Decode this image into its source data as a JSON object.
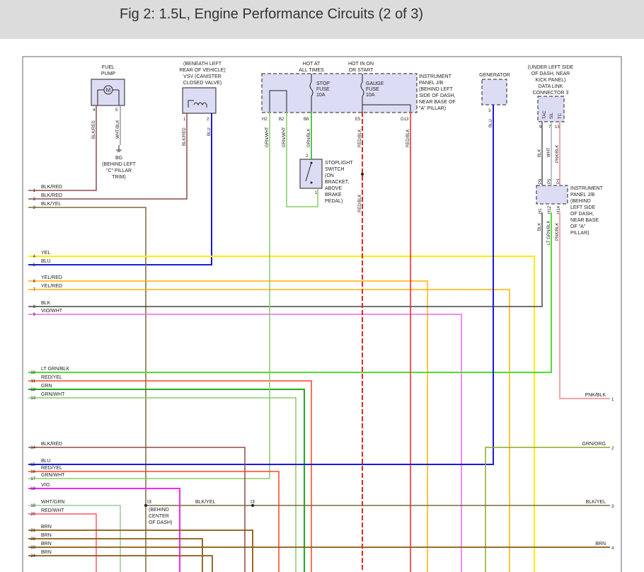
{
  "header": {
    "title": "Fig 2: 1.5L, Engine Performance Circuits (2 of 3)"
  },
  "components": {
    "fuel_pump": {
      "label1": "FUEL",
      "label2": "PUMP",
      "motor": "M",
      "pin_a": "4",
      "pin_b": "5"
    },
    "vsv": {
      "l1": "(BENEATH LEFT",
      "l2": "REAR OF VEHICLE)",
      "l3": "VSV (CANISTER",
      "l4": "CLOSED VALVE)",
      "pin_a": "1",
      "pin_b": "2"
    },
    "hot_all": {
      "l1": "HOT AT",
      "l2": "ALL TIMES"
    },
    "hot_on": {
      "l1": "HOT IN ON",
      "l2": "OR START"
    },
    "jb": {
      "l1": "INSTRUMENT",
      "l2": "PANEL J/B",
      "l3": "(BEHIND LEFT",
      "l4": "SIDE OF DASH,",
      "l5": "NEAR BASE OF",
      "l6": "\"A\" PILLAR)"
    },
    "stop_fuse": {
      "l1": "STOP",
      "l2": "FUSE",
      "l3": "10A"
    },
    "gauge_fuse": {
      "l1": "GAUGE",
      "l2": "FUSE",
      "l3": "10A"
    },
    "jb_pins": {
      "h2": "H2",
      "b2": "B2",
      "b8": "B8",
      "e5": "E5",
      "g13": "G13"
    },
    "generator": {
      "label": "GENERATOR",
      "pin": "3"
    },
    "dlc": {
      "l1": "(UNDER LEFT SIDE",
      "l2": "OF DASH, NEAR",
      "l3": "KICK PANEL)",
      "l4": "DATA LINK",
      "l5": "CONNECTOR 3",
      "t1": "TAC",
      "t2": "SIL",
      "t3": "TC",
      "p1": "9",
      "p2": "7",
      "p3": "13"
    },
    "ground_bg": {
      "l1": "BG",
      "l2": "(BEHIND LEFT",
      "l3": "\"C\" PILLAR",
      "l4": "TRIM)"
    },
    "stoplight": {
      "l1": "STOPLIGHT",
      "l2": "SWITCH",
      "l3": "(ON",
      "l4": "BRACKET,",
      "l5": "ABOVE",
      "l6": "BRAKE",
      "l7": "PEDAL)",
      "pin2": "2",
      "pin1": "1"
    },
    "ip_jb2": {
      "l1": "INSTRUMENT",
      "l2": "PANEL J/B",
      "l3": "(BEHIND",
      "l4": "LEFT SIDE",
      "l5": "OF DASH,",
      "l6": "NEAR BASE",
      "l7": "OF \"A\"",
      "l8": "PILLAR)",
      "top": [
        "P9",
        "P5",
        "P3"
      ],
      "bottom": [
        "H1",
        "H12",
        "H14"
      ]
    },
    "splice_i3": {
      "name": "I3",
      "l1": "(BEHIND",
      "l2": "CENTER",
      "l3": "OF DASH)"
    }
  },
  "wire_labels": {
    "fp4": "BLK/RED",
    "fp5": "WHT/BLK",
    "vsv1": "BLK/RED",
    "vsv2": "BLU",
    "h2": "GRN/WHT",
    "b2": "GRN/WHT",
    "b8": "GRN/BLK",
    "e5": "RED/BLK",
    "e5b": "RED/BLK",
    "g13": "RED/BLK",
    "gen": "BLU",
    "dlc9": "BLK",
    "dlc7": "WHT",
    "dlc13": "PNK/BLK",
    "h1": "BLK",
    "h12": "LT GRN/BLK",
    "h14": "PNK/BLK"
  },
  "left_wires": [
    {
      "num": "1",
      "label": "BLK/RED"
    },
    {
      "num": "2",
      "label": "BLK/RED"
    },
    {
      "num": "3",
      "label": "BLK/YEL"
    },
    {
      "num": "4",
      "label": "YEL"
    },
    {
      "num": "5",
      "label": "BLU"
    },
    {
      "num": "6",
      "label": "YEL/RED"
    },
    {
      "num": "7",
      "label": "YEL/RED"
    },
    {
      "num": "8",
      "label": "BLK"
    },
    {
      "num": "9",
      "label": "VIO/WHT"
    },
    {
      "num": "10",
      "label": "LT GRN/BLK"
    },
    {
      "num": "11",
      "label": "RED/YEL"
    },
    {
      "num": "12",
      "label": "GRN"
    },
    {
      "num": "13",
      "label": "GRN/WHT"
    },
    {
      "num": "14",
      "label": "BLK/RED"
    },
    {
      "num": "15",
      "label": "BLU"
    },
    {
      "num": "16",
      "label": "RED/YEL"
    },
    {
      "num": "17",
      "label": "GRN/WHT"
    },
    {
      "num": "18",
      "label": "VIO"
    },
    {
      "num": "19",
      "label": "WHT/GRN"
    },
    {
      "num": "20",
      "label": "RED/WHT"
    },
    {
      "num": "21",
      "label": "BRN"
    },
    {
      "num": "22",
      "label": "BRN"
    },
    {
      "num": "23",
      "label": "BRN"
    },
    {
      "num": "24",
      "label": "BRN"
    }
  ],
  "right_wires": [
    {
      "num": "1",
      "label": "PNK/BLK"
    },
    {
      "num": "2",
      "label": "GRN/ORG"
    },
    {
      "num": "3",
      "label": "BLK/YEL"
    },
    {
      "num": "4",
      "label": "BRN"
    }
  ],
  "mid_labels": {
    "blk_yel": "BLK/YEL",
    "i3b": "I3"
  },
  "colors": {
    "blk_red": "#8b4a4a",
    "blk_yel": "#7a6a3a",
    "yel": "#ffee00",
    "blu": "#1a1add",
    "yel_red": "#ffb000",
    "blk": "#444444",
    "vio_wht": "#ee66ee",
    "lt_grn_blk": "#55dd33",
    "red_yel": "#ff4422",
    "grn": "#22aa22",
    "grn_wht": "#88cc66",
    "vio": "#ff22ff",
    "wht_grn": "#99cc99",
    "red_wht": "#ff5566",
    "brn": "#8a5a10",
    "red_blk": "#ee2222",
    "pnk_blk": "#ee8888",
    "grn_org": "#88aa22",
    "box_fill": "#dcdcf4"
  }
}
